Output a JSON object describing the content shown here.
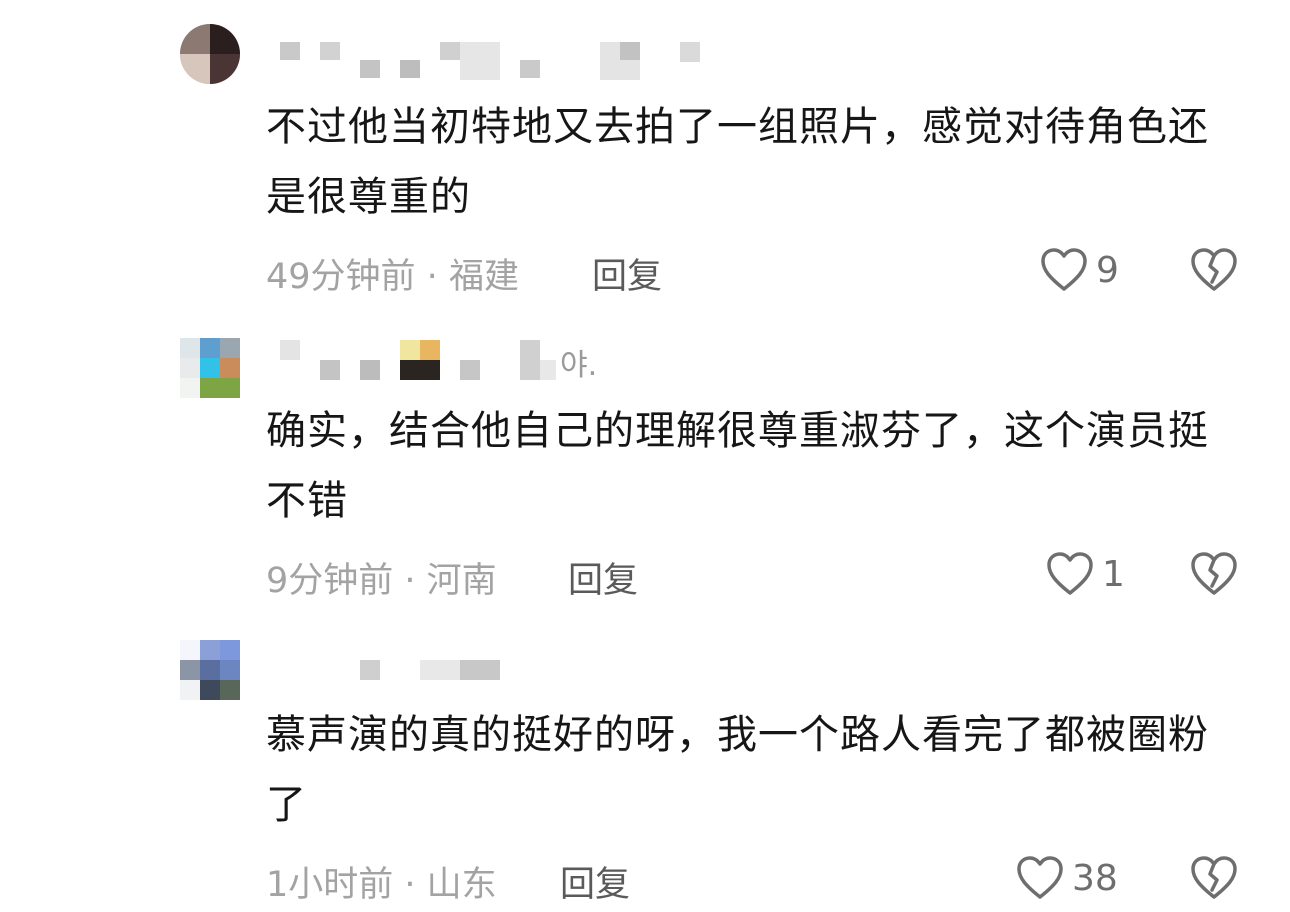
{
  "comments": [
    {
      "text": "不过他当初特地又去拍了一组照片，感觉对待角色还是很尊重的",
      "time": "49分钟前",
      "location": "福建",
      "reply_label": "回复",
      "likes": "9"
    },
    {
      "username_suffix": "야.",
      "text": "确实，结合他自己的理解很尊重淑芬了，这个演员挺不错",
      "time": "9分钟前",
      "location": "河南",
      "reply_label": "回复",
      "likes": "1"
    },
    {
      "text": "慕声演的真的挺好的呀，我一个路人看完了都被圈粉了",
      "time": "1小时前",
      "location": "山东",
      "reply_label": "回复",
      "likes": "38"
    }
  ],
  "meta_separator": " · ",
  "icons": {
    "like": "heart-outline-icon",
    "dislike": "broken-heart-icon"
  },
  "colors": {
    "text": "#161616",
    "meta": "#a3a3a3",
    "icon": "#6e6e6e"
  }
}
